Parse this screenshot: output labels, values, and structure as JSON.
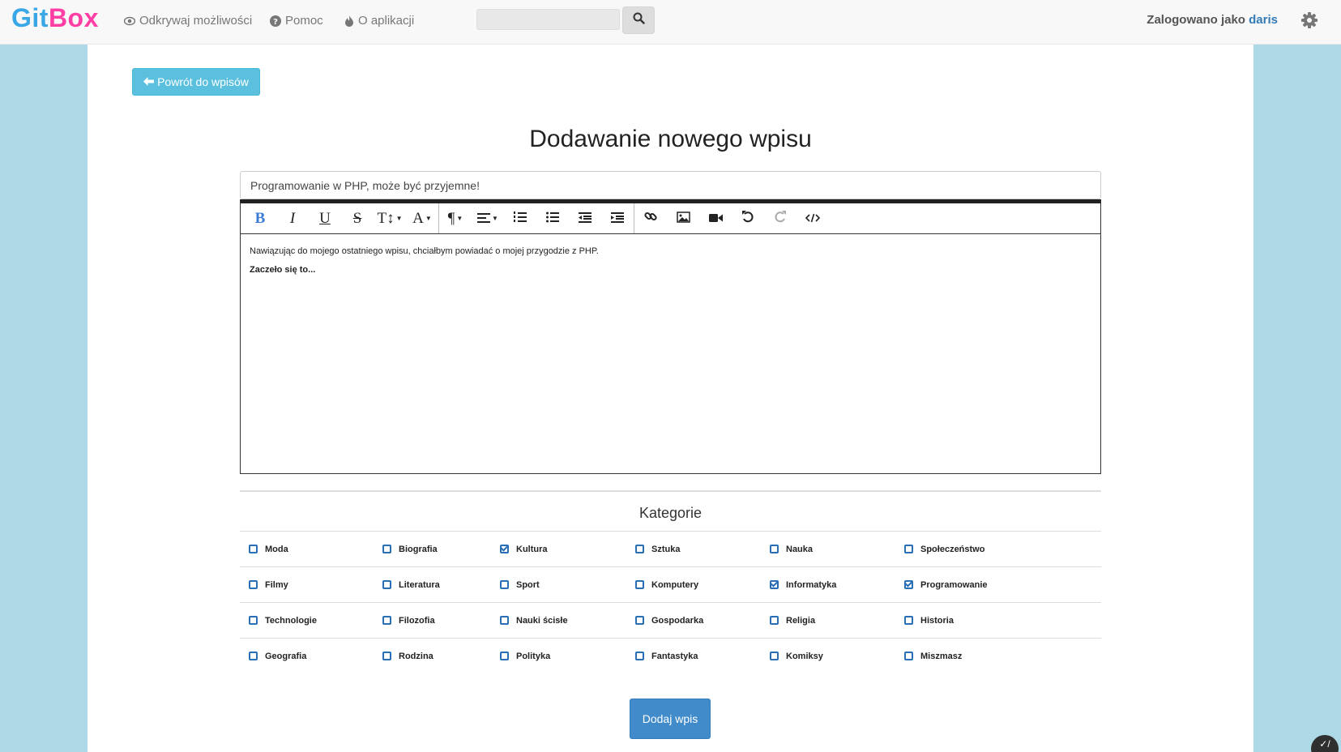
{
  "navbar": {
    "brand_git": "Git",
    "brand_box": "Box",
    "links": [
      {
        "label": "Odkrywaj możliwości",
        "icon": "eye-icon"
      },
      {
        "label": "Pomoc",
        "icon": "question-circle-icon"
      },
      {
        "label": "O aplikacji",
        "icon": "fire-icon"
      }
    ],
    "search": {
      "value": "",
      "placeholder": ""
    },
    "logged_prefix": "Zalogowano jako ",
    "logged_user": "daris"
  },
  "main": {
    "back_label": "Powrót do wpisów",
    "title": "Dodawanie nowego wpisu",
    "post_title_value": "Programowanie w PHP, może być przyjemne!",
    "editor": {
      "paragraph_1": "Nawiązując do mojego ostatniego wpisu, chciałbym powiadać o mojej przygodzie z PHP.",
      "paragraph_2": "Zaczeło się to..."
    },
    "categories_title": "Kategorie",
    "categories": [
      [
        {
          "label": "Moda",
          "checked": false
        },
        {
          "label": "Biografia",
          "checked": false
        },
        {
          "label": "Kultura",
          "checked": true
        },
        {
          "label": "Sztuka",
          "checked": false
        },
        {
          "label": "Nauka",
          "checked": false
        },
        {
          "label": "Społeczeństwo",
          "checked": false
        }
      ],
      [
        {
          "label": "Filmy",
          "checked": false
        },
        {
          "label": "Literatura",
          "checked": false
        },
        {
          "label": "Sport",
          "checked": false
        },
        {
          "label": "Komputery",
          "checked": false
        },
        {
          "label": "Informatyka",
          "checked": true
        },
        {
          "label": "Programowanie",
          "checked": true
        }
      ],
      [
        {
          "label": "Technologie",
          "checked": false
        },
        {
          "label": "Filozofia",
          "checked": false
        },
        {
          "label": "Nauki ścisłe",
          "checked": false
        },
        {
          "label": "Gospodarka",
          "checked": false
        },
        {
          "label": "Religia",
          "checked": false
        },
        {
          "label": "Historia",
          "checked": false
        }
      ],
      [
        {
          "label": "Geografia",
          "checked": false
        },
        {
          "label": "Rodzina",
          "checked": false
        },
        {
          "label": "Polityka",
          "checked": false
        },
        {
          "label": "Fantastyka",
          "checked": false
        },
        {
          "label": "Komiksy",
          "checked": false
        },
        {
          "label": "Miszmasz",
          "checked": false
        }
      ]
    ],
    "submit_label": "Dodaj wpis"
  },
  "colors": {
    "brand_git": "#3aa8e6",
    "brand_box": "#ff3fa4",
    "background": "#add8e6",
    "info_button": "#5bc0de",
    "primary_button": "#428bca",
    "checkbox": "#2a6eb6"
  }
}
